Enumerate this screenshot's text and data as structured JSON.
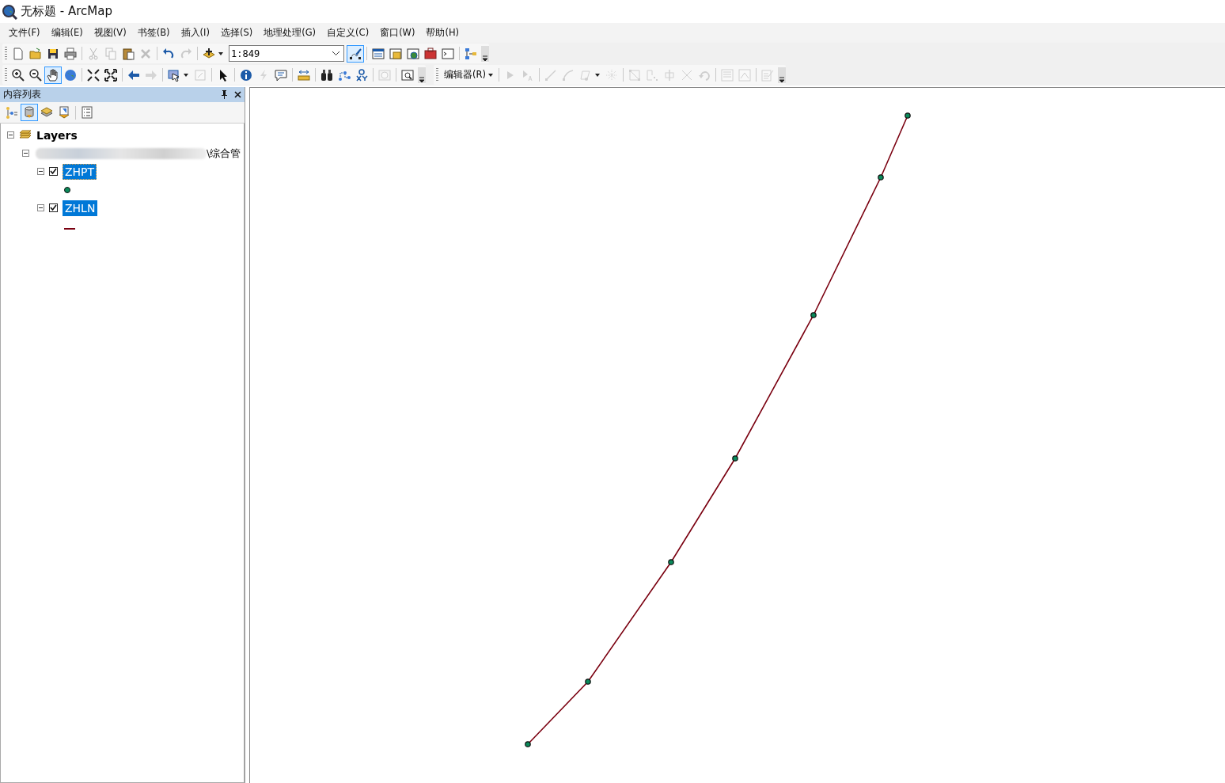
{
  "window": {
    "title": "无标题 - ArcMap"
  },
  "menu": [
    "文件(F)",
    "编辑(E)",
    "视图(V)",
    "书签(B)",
    "插入(I)",
    "选择(S)",
    "地理处理(G)",
    "自定义(C)",
    "窗口(W)",
    "帮助(H)"
  ],
  "toolbars": [
    {
      "items": [
        {
          "kind": "tool",
          "disabled": false,
          "selected": false
        },
        {
          "kind": "tool",
          "disabled": false,
          "selected": false
        },
        {
          "kind": "tool",
          "disabled": false,
          "selected": false
        },
        {
          "kind": "tool",
          "disabled": false,
          "selected": false
        },
        {
          "kind": "separator"
        },
        {
          "kind": "tool",
          "disabled": true,
          "selected": false
        },
        {
          "kind": "tool",
          "disabled": true,
          "selected": false
        },
        {
          "kind": "tool",
          "disabled": false,
          "selected": false
        },
        {
          "kind": "tool",
          "disabled": true,
          "selected": false
        },
        {
          "kind": "separator"
        },
        {
          "kind": "tool",
          "disabled": false,
          "selected": false
        },
        {
          "kind": "tool",
          "disabled": true,
          "selected": false
        },
        {
          "kind": "separator"
        },
        {
          "kind": "tool",
          "disabled": false,
          "selected": false
        },
        {
          "kind": "caret"
        },
        {
          "kind": "scale",
          "value": "1:849"
        },
        {
          "kind": "tool",
          "disabled": false,
          "selected": true
        },
        {
          "kind": "separator"
        },
        {
          "kind": "tool",
          "disabled": false,
          "selected": false
        },
        {
          "kind": "tool",
          "disabled": false,
          "selected": false
        },
        {
          "kind": "tool",
          "disabled": false,
          "selected": false
        },
        {
          "kind": "tool",
          "disabled": false,
          "selected": false
        },
        {
          "kind": "tool",
          "disabled": false,
          "selected": false
        },
        {
          "kind": "separator"
        },
        {
          "kind": "tool",
          "disabled": false,
          "selected": false
        },
        {
          "kind": "overflow"
        }
      ]
    },
    {
      "items": [
        {
          "kind": "tool",
          "disabled": false,
          "selected": false
        },
        {
          "kind": "tool",
          "disabled": false,
          "selected": false
        },
        {
          "kind": "tool",
          "disabled": false,
          "selected": true
        },
        {
          "kind": "tool",
          "disabled": false,
          "selected": false
        },
        {
          "kind": "separator"
        },
        {
          "kind": "tool",
          "disabled": false,
          "selected": false
        },
        {
          "kind": "tool",
          "disabled": false,
          "selected": false
        },
        {
          "kind": "separator"
        },
        {
          "kind": "tool",
          "disabled": false,
          "selected": false
        },
        {
          "kind": "tool",
          "disabled": true,
          "selected": false
        },
        {
          "kind": "separator"
        },
        {
          "kind": "tool",
          "disabled": false,
          "selected": false
        },
        {
          "kind": "caret"
        },
        {
          "kind": "tool",
          "disabled": true,
          "selected": false
        },
        {
          "kind": "separator"
        },
        {
          "kind": "tool",
          "disabled": false,
          "selected": false
        },
        {
          "kind": "separator"
        },
        {
          "kind": "tool",
          "disabled": false,
          "selected": false
        },
        {
          "kind": "tool",
          "disabled": true,
          "selected": false
        },
        {
          "kind": "tool",
          "disabled": false,
          "selected": false
        },
        {
          "kind": "separator"
        },
        {
          "kind": "tool",
          "disabled": false,
          "selected": false
        },
        {
          "kind": "separator"
        },
        {
          "kind": "tool",
          "disabled": false,
          "selected": false
        },
        {
          "kind": "tool",
          "disabled": false,
          "selected": false
        },
        {
          "kind": "tool",
          "disabled": false,
          "selected": false
        },
        {
          "kind": "separator"
        },
        {
          "kind": "tool",
          "disabled": true,
          "selected": false
        },
        {
          "kind": "separator"
        },
        {
          "kind": "tool",
          "disabled": false,
          "selected": false
        },
        {
          "kind": "overflow"
        }
      ]
    },
    {
      "items": [
        {
          "kind": "menu",
          "label": "编辑器(R)"
        },
        {
          "kind": "separator"
        },
        {
          "kind": "tool",
          "disabled": true,
          "selected": false
        },
        {
          "kind": "tool",
          "disabled": true,
          "selected": false
        },
        {
          "kind": "separator"
        },
        {
          "kind": "tool",
          "disabled": true,
          "selected": false
        },
        {
          "kind": "tool",
          "disabled": true,
          "selected": false
        },
        {
          "kind": "tool",
          "disabled": true,
          "selected": false
        },
        {
          "kind": "caret"
        },
        {
          "kind": "tool",
          "disabled": true,
          "selected": false
        },
        {
          "kind": "separator"
        },
        {
          "kind": "tool",
          "disabled": true,
          "selected": false
        },
        {
          "kind": "tool",
          "disabled": true,
          "selected": false
        },
        {
          "kind": "tool",
          "disabled": true,
          "selected": false
        },
        {
          "kind": "tool",
          "disabled": true,
          "selected": false
        },
        {
          "kind": "tool",
          "disabled": true,
          "selected": false
        },
        {
          "kind": "separator"
        },
        {
          "kind": "tool",
          "disabled": true,
          "selected": false
        },
        {
          "kind": "tool",
          "disabled": true,
          "selected": false
        },
        {
          "kind": "separator"
        },
        {
          "kind": "tool",
          "disabled": true,
          "selected": false
        },
        {
          "kind": "overflow"
        }
      ]
    }
  ],
  "toc": {
    "title": "内容列表",
    "toolbar": [
      {
        "kind": "tool",
        "selected": false
      },
      {
        "kind": "tool",
        "selected": true
      },
      {
        "kind": "tool",
        "selected": false
      },
      {
        "kind": "tool",
        "selected": false
      },
      {
        "kind": "separator"
      },
      {
        "kind": "tool",
        "selected": false
      }
    ],
    "tree": [
      {
        "kind": "frame",
        "label": "Layers",
        "expanded": true,
        "children": [
          {
            "kind": "source",
            "label": "\\综合管",
            "expanded": true,
            "children": [
              {
                "kind": "layer",
                "label": "ZHPT",
                "checked": true,
                "selected": true,
                "focused": true,
                "expanded": true,
                "legend": {
                  "kind": "point"
                }
              },
              {
                "kind": "layer",
                "label": "ZHLN",
                "checked": true,
                "selected": true,
                "focused": false,
                "expanded": true,
                "legend": {
                  "kind": "line"
                }
              }
            ]
          }
        ]
      }
    ]
  }
}
